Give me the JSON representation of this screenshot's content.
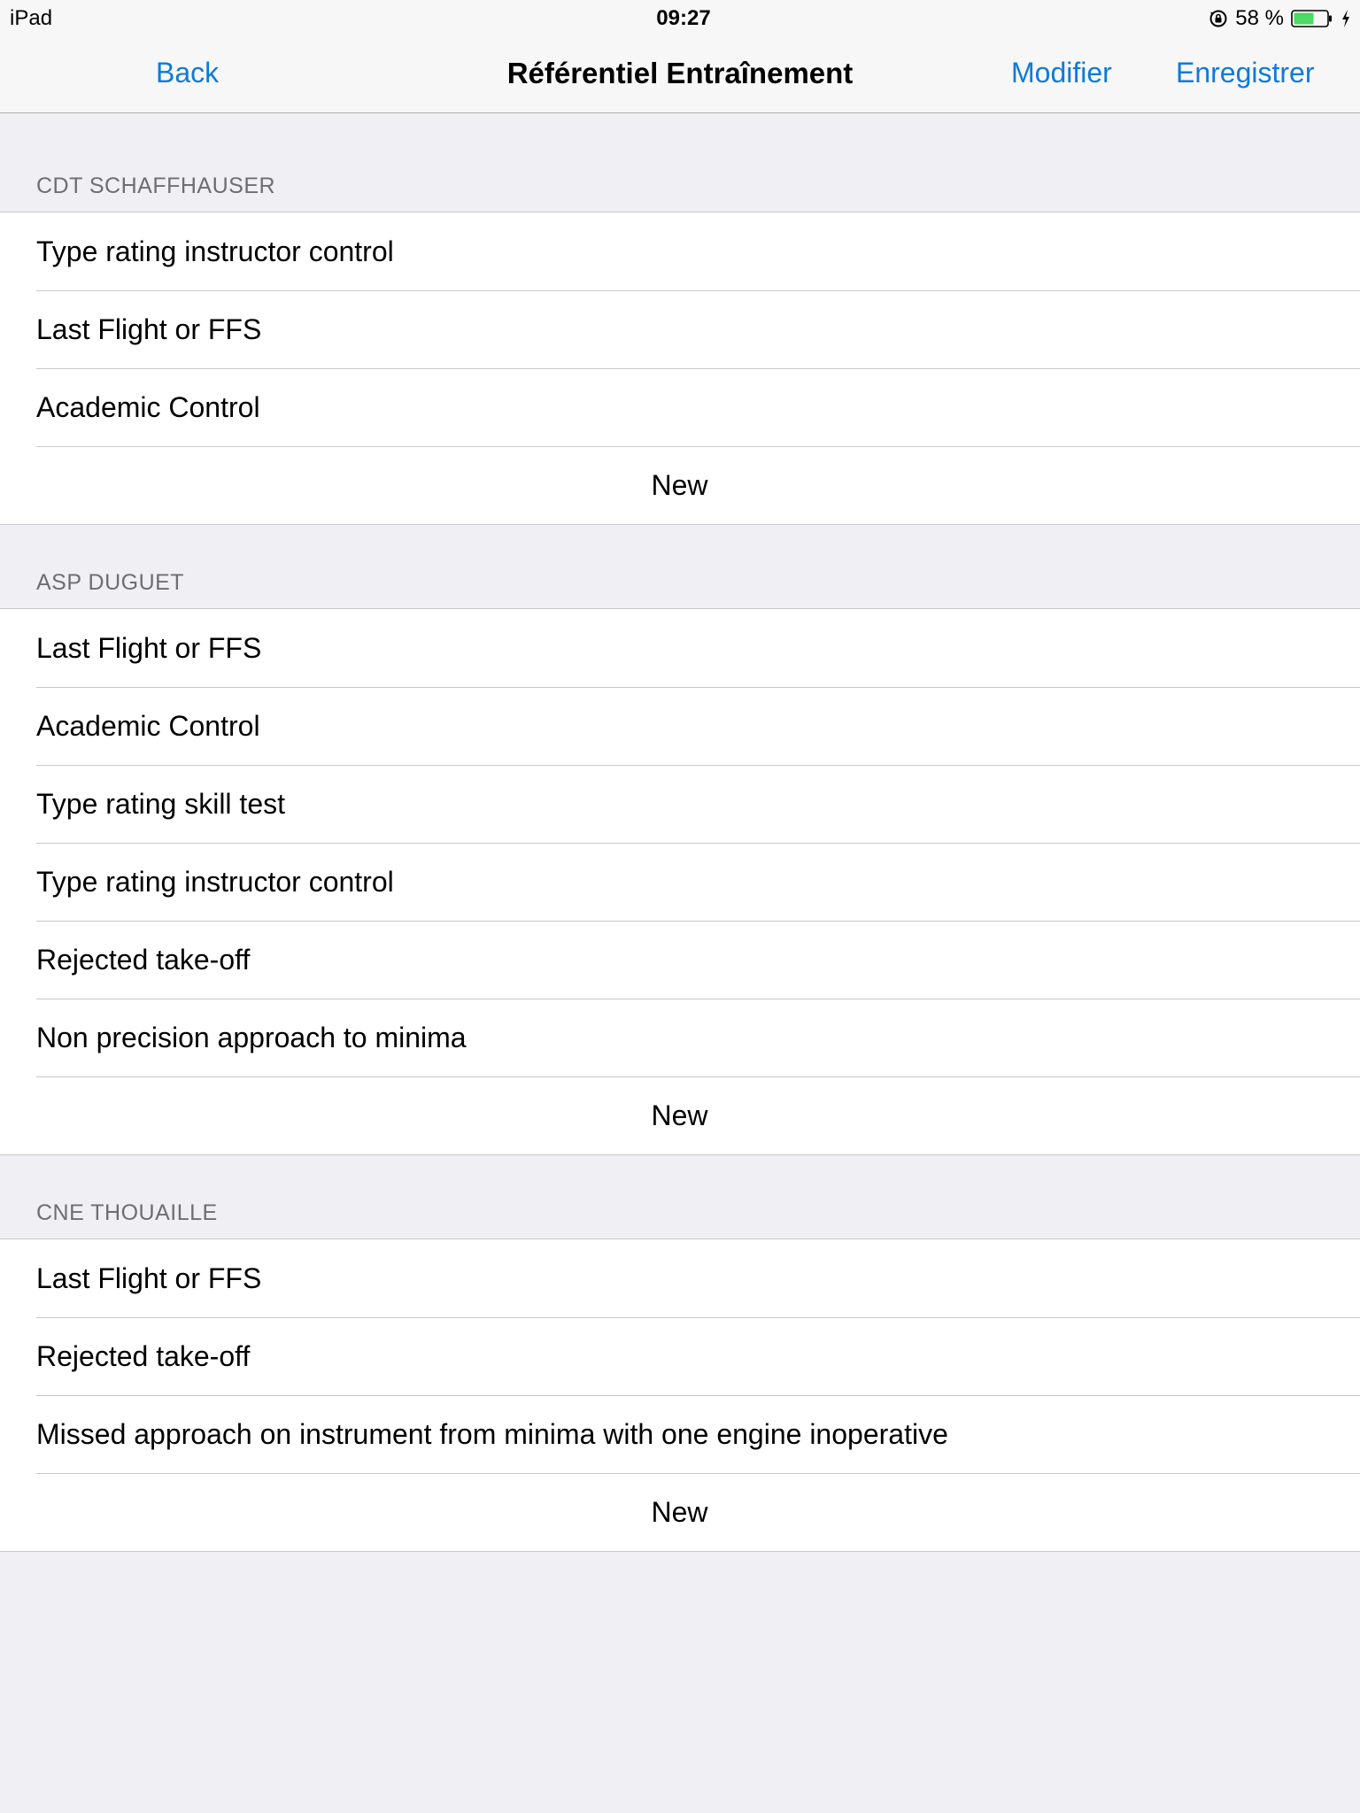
{
  "status_bar": {
    "device": "iPad",
    "time": "09:27",
    "battery": "58 %"
  },
  "nav": {
    "back_label": "Back",
    "title": "Référentiel Entraînement",
    "edit_label": "Modifier",
    "save_label": "Enregistrer",
    "accent_color": "#0f7ad9"
  },
  "sections": [
    {
      "header": "CDT SCHAFFHAUSER",
      "items": [
        "Type rating instructor control",
        "Last Flight or FFS",
        "Academic Control"
      ],
      "new_label": "New"
    },
    {
      "header": "ASP DUGUET",
      "items": [
        "Last Flight or FFS",
        "Academic Control",
        "Type rating skill test",
        "Type rating instructor control",
        "Rejected take-off",
        "Non precision approach to minima"
      ],
      "new_label": "New"
    },
    {
      "header": "CNE THOUAILLE",
      "items": [
        "Last Flight or FFS",
        "Rejected take-off",
        "Missed approach on instrument from minima with one engine inoperative"
      ],
      "new_label": "New"
    }
  ]
}
